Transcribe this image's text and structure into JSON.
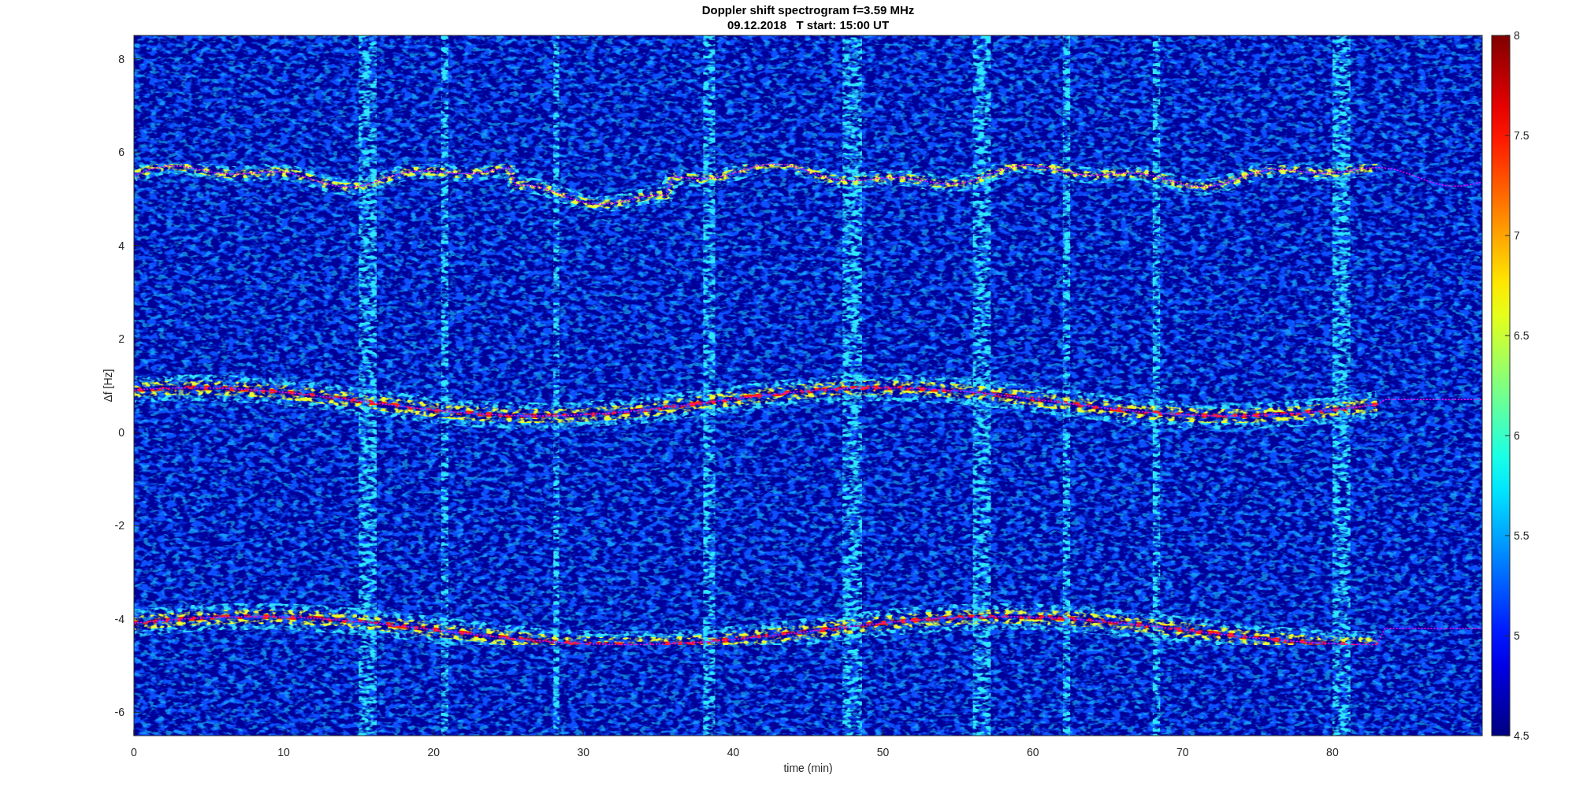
{
  "figure": {
    "title": "Doppler shift spectrogram f=3.59 MHz",
    "subtitle": "09.12.2018   T start: 15:00 UT"
  },
  "axes": {
    "xlabel": "time (min)",
    "ylabel": "Δf [Hz]",
    "xticks": [
      "0",
      "10",
      "20",
      "30",
      "40",
      "50",
      "60",
      "70",
      "80"
    ],
    "yticks": [
      "8",
      "6",
      "4",
      "2",
      "0",
      "-2",
      "-4",
      "-6"
    ]
  },
  "colorbar": {
    "ticks": [
      "8",
      "7.5",
      "7",
      "6.5",
      "6",
      "5.5",
      "5",
      "4.5"
    ]
  }
}
